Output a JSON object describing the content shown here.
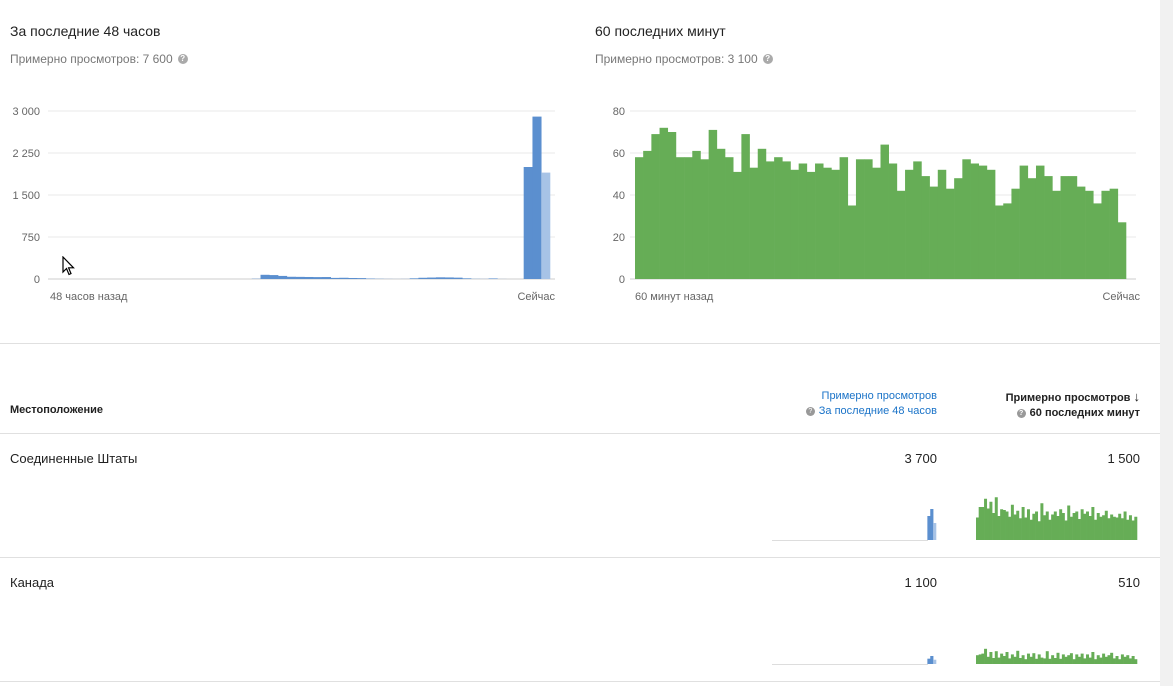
{
  "panels": {
    "left": {
      "title": "За последние 48 часов",
      "subtitle": "Примерно просмотров: 7 600",
      "xlabel_left": "48 часов назад",
      "xlabel_right": "Сейчас"
    },
    "right": {
      "title": "60 последних минут",
      "subtitle": "Примерно просмотров: 3 100",
      "xlabel_left": "60 минут назад",
      "xlabel_right": "Сейчас"
    }
  },
  "table": {
    "location_header": "Местоположение",
    "col1_line1": "Примерно просмотров",
    "col1_line2": "За последние 48 часов",
    "col2_line1": "Примерно просмотров",
    "col2_line2": "60 последних минут",
    "sort_arrow": "↓",
    "rows": [
      {
        "name": "Соединенные Штаты",
        "views_48h": "3 700",
        "views_60m": "1 500"
      },
      {
        "name": "Канада",
        "views_48h": "1 100",
        "views_60m": "510"
      }
    ]
  },
  "icons": {
    "help": "help-circle-icon",
    "cursor": "mouse-pointer-icon",
    "sort": "arrow-down-icon"
  },
  "colors": {
    "blue": "#5b8fcf",
    "light_blue": "#a7c3e6",
    "green": "#66ad56",
    "link": "#1a73c8"
  },
  "chart_data": [
    {
      "type": "bar",
      "title": "За последние 48 часов",
      "ylim": [
        0,
        3000
      ],
      "y_ticks": [
        "0",
        "750",
        "1 500",
        "2 250",
        "3 000"
      ],
      "y_tick_values": [
        0,
        750,
        1500,
        2250,
        3000
      ],
      "grid": true,
      "series": [
        {
          "values": [
            0,
            0,
            0,
            0,
            0,
            0,
            0,
            0,
            0,
            0,
            0,
            0,
            0,
            0,
            0,
            0,
            0,
            0,
            0,
            0,
            0,
            0,
            0,
            5,
            75,
            70,
            55,
            40,
            38,
            36,
            34,
            35,
            20,
            22,
            18,
            16,
            8,
            4,
            2,
            1,
            2,
            12,
            22,
            26,
            30,
            28,
            24,
            12,
            3,
            2,
            10,
            1,
            0,
            0,
            2000,
            2900,
            1900
          ]
        }
      ],
      "last_bar_partial": true
    },
    {
      "type": "bar",
      "title": "60 последних минут",
      "ylim": [
        0,
        80
      ],
      "y_ticks": [
        "0",
        "20",
        "40",
        "60",
        "80"
      ],
      "y_tick_values": [
        0,
        20,
        40,
        60,
        80
      ],
      "grid": true,
      "series": [
        {
          "values": [
            58,
            61,
            69,
            72,
            70,
            58,
            58,
            61,
            57,
            71,
            62,
            58,
            51,
            69,
            53,
            62,
            56,
            58,
            56,
            52,
            55,
            51,
            55,
            53,
            52,
            58,
            35,
            57,
            57,
            53,
            64,
            55,
            42,
            52,
            56,
            49,
            44,
            52,
            43,
            48,
            57,
            55,
            54,
            52,
            35,
            36,
            43,
            54,
            48,
            54,
            49,
            42,
            49,
            49,
            44,
            42,
            36,
            42,
            43,
            27
          ]
        }
      ]
    },
    {
      "type": "bar",
      "title": "",
      "ylim": [
        0,
        3000
      ],
      "series": [
        {
          "values": [
            0,
            0,
            0,
            0,
            0,
            0,
            0,
            0,
            0,
            0,
            0,
            0,
            0,
            0,
            0,
            0,
            0,
            0,
            0,
            0,
            0,
            0,
            0,
            0,
            0,
            0,
            0,
            0,
            0,
            0,
            0,
            0,
            0,
            0,
            0,
            0,
            0,
            0,
            0,
            0,
            0,
            0,
            0,
            0,
            0,
            0,
            0,
            0,
            0,
            0,
            0,
            0,
            0,
            0,
            1200,
            1550,
            850
          ]
        }
      ]
    },
    {
      "type": "bar",
      "title": "",
      "ylim": [
        0,
        80
      ],
      "series": [
        {
          "values": [
            30,
            44,
            44,
            55,
            42,
            51,
            36,
            57,
            32,
            41,
            40,
            38,
            31,
            47,
            34,
            39,
            29,
            44,
            30,
            41,
            27,
            35,
            38,
            25,
            49,
            33,
            38,
            27,
            34,
            38,
            32,
            41,
            36,
            26,
            46,
            31,
            36,
            38,
            28,
            41,
            35,
            38,
            32,
            44,
            27,
            36,
            31,
            33,
            39,
            29,
            34,
            31,
            30,
            35,
            29,
            38,
            27,
            33,
            26,
            31
          ]
        }
      ]
    },
    {
      "type": "bar",
      "title": "",
      "ylim": [
        0,
        3000
      ],
      "series": [
        {
          "values": [
            0,
            0,
            0,
            0,
            0,
            0,
            0,
            0,
            0,
            0,
            0,
            0,
            0,
            0,
            0,
            0,
            0,
            0,
            0,
            0,
            0,
            0,
            0,
            0,
            0,
            0,
            0,
            0,
            0,
            0,
            0,
            0,
            0,
            0,
            0,
            0,
            0,
            0,
            0,
            0,
            0,
            0,
            0,
            0,
            0,
            0,
            0,
            0,
            0,
            0,
            0,
            0,
            0,
            0,
            500,
            750,
            400
          ]
        }
      ]
    },
    {
      "type": "bar",
      "title": "",
      "ylim": [
        0,
        80
      ],
      "series": [
        {
          "values": [
            22,
            24,
            26,
            38,
            18,
            30,
            15,
            32,
            16,
            26,
            20,
            30,
            14,
            24,
            18,
            33,
            15,
            22,
            12,
            26,
            18,
            27,
            13,
            24,
            16,
            14,
            32,
            13,
            22,
            15,
            28,
            13,
            24,
            18,
            22,
            27,
            12,
            24,
            18,
            26,
            14,
            24,
            16,
            30,
            12,
            22,
            16,
            26,
            18,
            22,
            28,
            14,
            20,
            12,
            24,
            18,
            22,
            14,
            20,
            12
          ]
        }
      ]
    }
  ]
}
